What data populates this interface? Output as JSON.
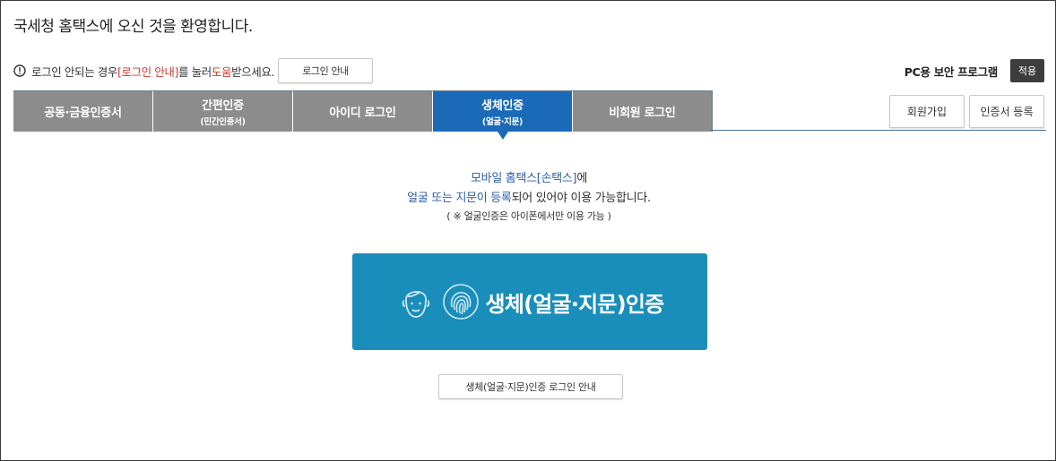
{
  "header": {
    "welcome": "국세청 홈택스에 오신 것을 환영합니다."
  },
  "notice": {
    "prefix": "로그인 안되는 경우 ",
    "link_guide": "[로그인 안내]",
    "middle": "를 눌러 ",
    "link_help": "도움",
    "suffix": "받으세요.",
    "button_label": "로그인 안내"
  },
  "security": {
    "label": "PC용 보안 프로그램",
    "apply_label": "적용"
  },
  "tabs": [
    {
      "label": "공동·금융인증서",
      "sub": ""
    },
    {
      "label": "간편인증",
      "sub": "(민간인증서)"
    },
    {
      "label": "아이디 로그인",
      "sub": ""
    },
    {
      "label": "생체인증",
      "sub": "(얼굴·지문)"
    },
    {
      "label": "비회원 로그인",
      "sub": ""
    }
  ],
  "active_tab": "생체인증",
  "right_buttons": {
    "join": "회원가입",
    "register_cert": "인증서 등록"
  },
  "content": {
    "line1_blue": "모바일 홈택스[손택스]",
    "line1_rest": "에",
    "line2_blue": "얼굴 또는 지문이 등록",
    "line2_rest": "되어 있어야 이용 가능합니다.",
    "note": "( ※ 얼굴인증은 아이폰에서만 이용 가능 )",
    "bio_button_label": "생체(얼굴·지문)인증",
    "guide_button_label": "생체(얼굴·지문)인증 로그인 안내"
  },
  "colors": {
    "tab_inactive": "#8c8c8c",
    "tab_active": "#1a6ab8",
    "bio_button": "#1a8eba",
    "highlight_red": "#d03a2f",
    "highlight_blue": "#2d5ea8"
  },
  "icons": {
    "notice": "info-circle-icon",
    "face": "face-icon",
    "fingerprint": "fingerprint-icon"
  }
}
